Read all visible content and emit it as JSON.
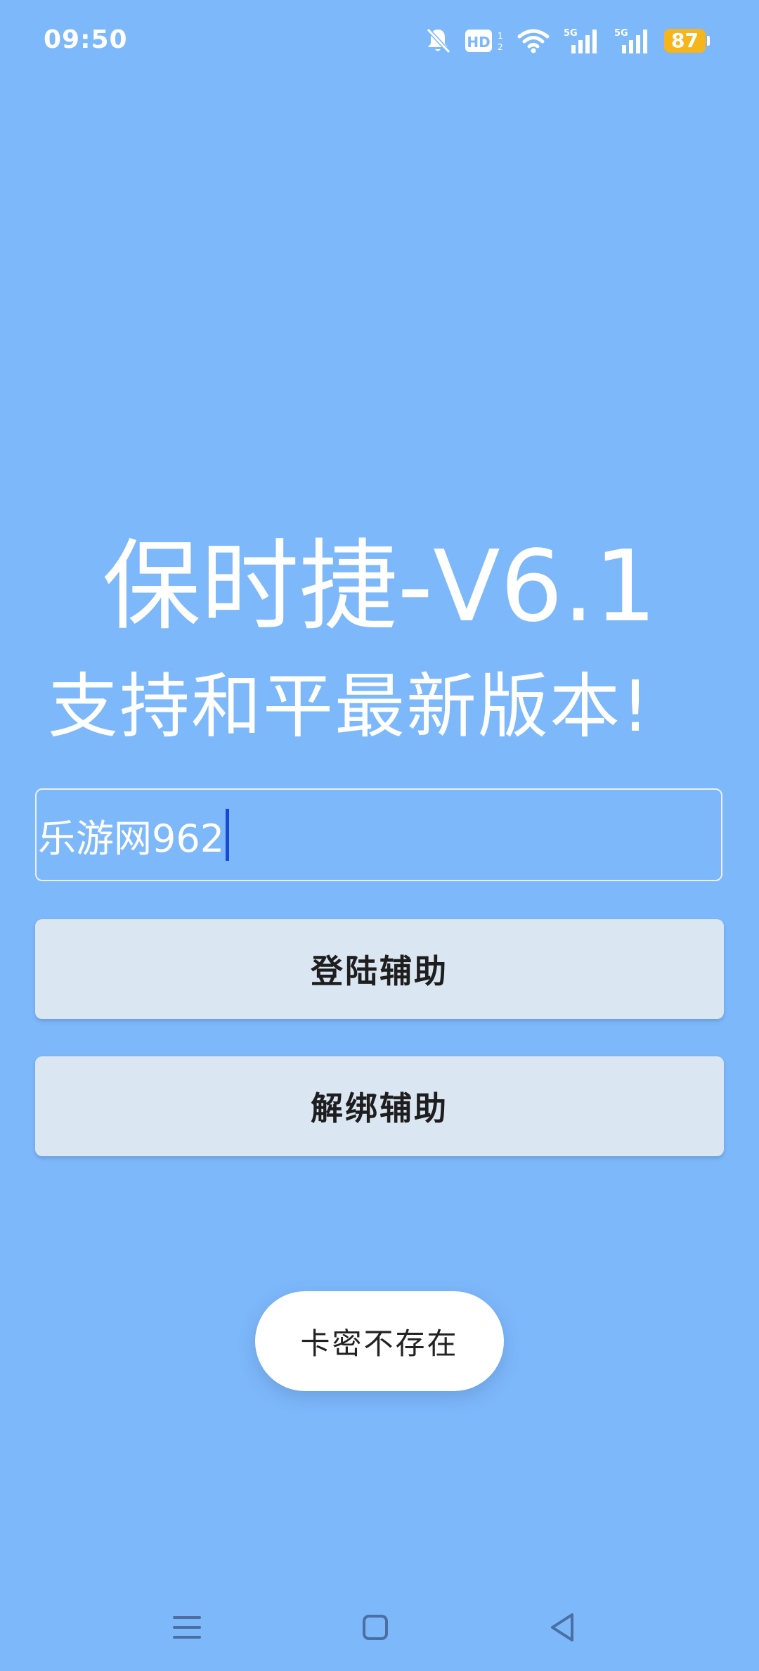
{
  "status_bar": {
    "time": "09:50",
    "battery": "87",
    "icons": [
      "bell-muted-icon",
      "hd-icon",
      "wifi-icon",
      "signal-5g-icon",
      "signal-5g-icon",
      "battery-icon"
    ],
    "hd_label": "HD",
    "network_label": "5G",
    "battery_color": "#f5b51b"
  },
  "header": {
    "title": "保时捷-V6.1",
    "subtitle": "支持和平最新版本!"
  },
  "form": {
    "card_value": "乐游网962"
  },
  "buttons": {
    "login_label": "登陆辅助",
    "unbind_label": "解绑辅助"
  },
  "toast": {
    "message": "卡密不存在"
  },
  "nav": {
    "icons": [
      "menu-icon",
      "home-icon",
      "back-icon"
    ]
  },
  "colors": {
    "background": "#7db8fb",
    "button_bg": "#dbe6f3",
    "caret": "#1a47d8"
  }
}
